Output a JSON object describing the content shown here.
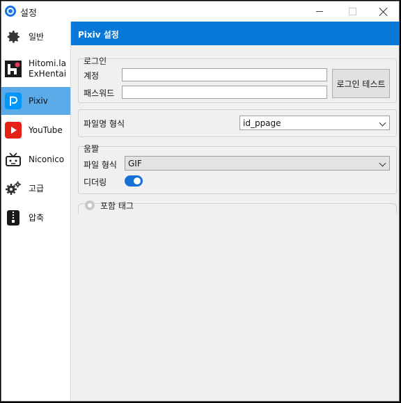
{
  "window": {
    "title": "설정",
    "app_icon": "app-icon"
  },
  "sidebar": {
    "items": [
      {
        "label": "일반",
        "icon": "gear-icon"
      },
      {
        "label": "Hitomi.la\nExHentai",
        "icon": "hitomi-icon"
      },
      {
        "label": "Pixiv",
        "icon": "pixiv-icon",
        "active": true
      },
      {
        "label": "YouTube",
        "icon": "youtube-icon"
      },
      {
        "label": "Niconico",
        "icon": "niconico-icon"
      },
      {
        "label": "고급",
        "icon": "gears-icon"
      },
      {
        "label": "압축",
        "icon": "zip-icon"
      }
    ]
  },
  "header": {
    "title": "Pixiv 설정"
  },
  "login": {
    "group_title": "로그인",
    "account_label": "계정",
    "account_value": "",
    "password_label": "패스워드",
    "password_value": "",
    "test_button": "로그인 테스트"
  },
  "filename": {
    "label": "파일명 형식",
    "value": "id_ppage"
  },
  "ugoira": {
    "group_title": "움짤",
    "format_label": "파일 형식",
    "format_value": "GIF",
    "dither_label": "디더링",
    "dither_on": true
  },
  "tags": {
    "label": "포함 태그",
    "checked": false
  },
  "colors": {
    "accent": "#0778d8",
    "sidebar_active": "#5aaae8",
    "toggle_on": "#1671d5"
  }
}
